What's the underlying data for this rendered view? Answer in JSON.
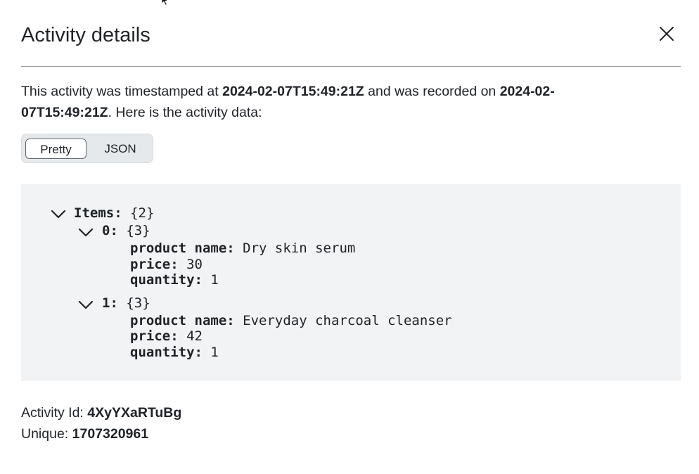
{
  "dialog": {
    "title": "Activity details",
    "description": {
      "prefix": "This activity was timestamped at ",
      "timestamp": "2024-02-07T15:49:21Z",
      "middle": " and was recorded on ",
      "recorded": "2024-02-07T15:49:21Z",
      "suffix": ". Here is the activity data:"
    },
    "view_toggle": {
      "options": [
        "Pretty",
        "JSON"
      ],
      "selected": "Pretty"
    },
    "data_tree": {
      "root_key": "Items:",
      "root_count": "{2}",
      "items": [
        {
          "key": "0:",
          "count": "{3}",
          "fields": [
            {
              "key": "product name:",
              "value": "Dry skin serum"
            },
            {
              "key": "price:",
              "value": "30"
            },
            {
              "key": "quantity:",
              "value": "1"
            }
          ]
        },
        {
          "key": "1:",
          "count": "{3}",
          "fields": [
            {
              "key": "product name:",
              "value": "Everyday charcoal cleanser"
            },
            {
              "key": "price:",
              "value": "42"
            },
            {
              "key": "quantity:",
              "value": "1"
            }
          ]
        }
      ]
    },
    "footer": {
      "activity_id_label": "Activity Id: ",
      "activity_id": "4XyYXaRTuBg",
      "unique_label": "Unique: ",
      "unique": "1707320961"
    }
  }
}
